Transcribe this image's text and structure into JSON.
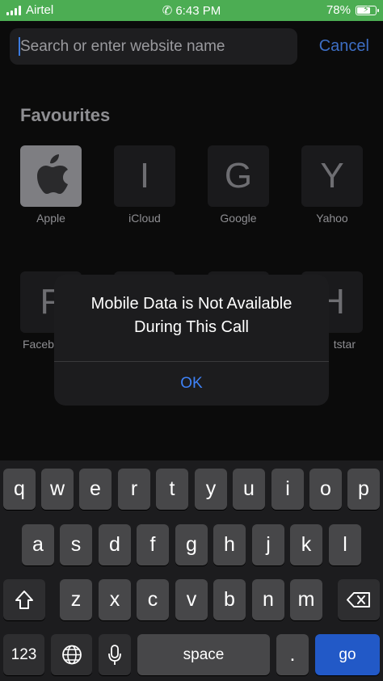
{
  "status_bar": {
    "carrier": "Airtel",
    "time": "6:43 PM",
    "battery_percent": "78%",
    "battery_level": 0.78,
    "background_color": "#4cad53"
  },
  "search": {
    "placeholder": "Search or enter website name",
    "cancel_label": "Cancel"
  },
  "favourites": {
    "title": "Favourites",
    "items": [
      {
        "label": "Apple",
        "glyph": ""
      },
      {
        "label": "iCloud",
        "glyph": "I"
      },
      {
        "label": "Google",
        "glyph": "G"
      },
      {
        "label": "Yahoo",
        "glyph": "Y"
      }
    ],
    "row2": [
      {
        "label": "Faceb",
        "glyph": "F"
      },
      {
        "label": "",
        "glyph": ""
      },
      {
        "label": "",
        "glyph": ""
      },
      {
        "label": "tstar",
        "glyph": "H"
      }
    ]
  },
  "alert": {
    "title_line1": "Mobile Data is Not Available",
    "title_line2": "During This Call",
    "button_label": "OK"
  },
  "keyboard": {
    "row1": [
      "q",
      "w",
      "e",
      "r",
      "t",
      "y",
      "u",
      "i",
      "o",
      "p"
    ],
    "row2": [
      "a",
      "s",
      "d",
      "f",
      "g",
      "h",
      "j",
      "k",
      "l"
    ],
    "row3": [
      "z",
      "x",
      "c",
      "v",
      "b",
      "n",
      "m"
    ],
    "numbers_label": "123",
    "space_label": "space",
    "period_label": ".",
    "go_label": "go"
  },
  "icons": [
    "signal-icon",
    "phone-icon",
    "battery-icon",
    "apple-logo-icon",
    "shift-icon",
    "backspace-icon",
    "globe-icon",
    "microphone-icon"
  ]
}
